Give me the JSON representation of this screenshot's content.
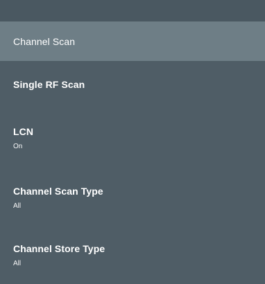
{
  "menu": {
    "items": [
      {
        "label": "Channel Scan",
        "value": "",
        "selected": true
      },
      {
        "label": "Single RF Scan",
        "value": "",
        "selected": false
      },
      {
        "label": "LCN",
        "value": "On",
        "selected": false
      },
      {
        "label": "Channel Scan Type",
        "value": "All",
        "selected": false
      },
      {
        "label": "Channel Store Type",
        "value": "All",
        "selected": false
      }
    ]
  },
  "colors": {
    "background": "#4f5d66",
    "selected_background": "#6e7e86",
    "text": "#ffffff"
  }
}
